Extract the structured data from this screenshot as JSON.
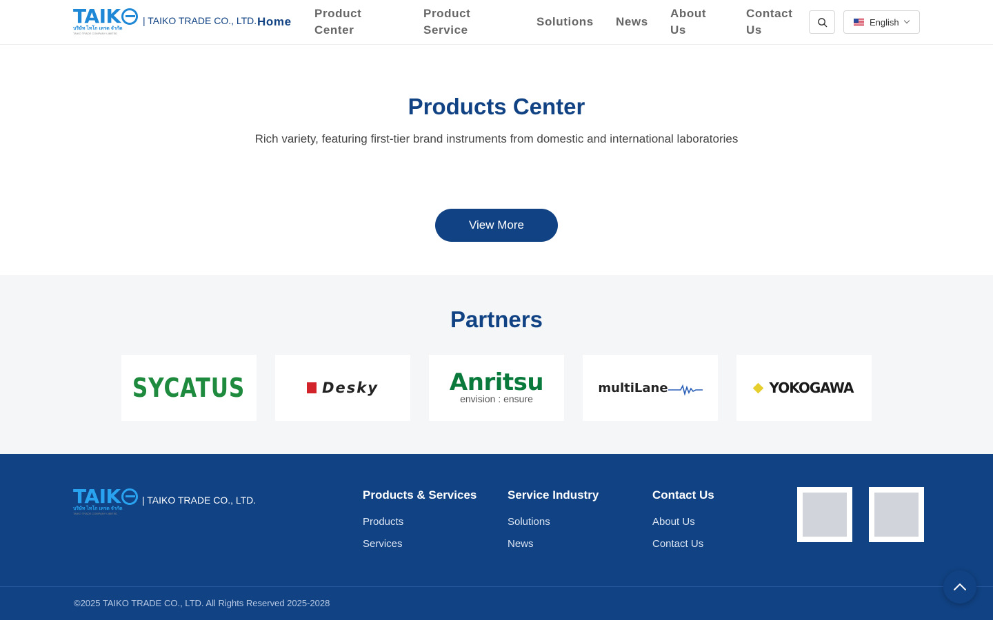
{
  "header": {
    "logo_text": "TAIK",
    "logo_thai": "บริษัท ไทโก เทรด จำกัด",
    "logo_tagline": "TAIKO TRADE COMPANY LIMITED",
    "company": "| TAIKO TRADE CO., LTD.",
    "nav": [
      {
        "label": "Home",
        "active": true
      },
      {
        "label": "Product Center"
      },
      {
        "label": "Product Service"
      },
      {
        "label": "Solutions"
      },
      {
        "label": "News"
      },
      {
        "label": "About Us"
      },
      {
        "label": "Contact Us"
      }
    ],
    "search_icon": "search-icon",
    "language": "English",
    "language_flag": "us-flag-icon"
  },
  "products": {
    "title": "Products Center",
    "subtitle": "Rich variety, featuring first-tier brand instruments from domestic and international laboratories",
    "view_more": "View More"
  },
  "partners": {
    "title": "Partners",
    "logos": [
      {
        "name": "SYCATUS"
      },
      {
        "name": "Desky"
      },
      {
        "name": "Anritsu",
        "tagline": "envision : ensure"
      },
      {
        "name": "multiLane"
      },
      {
        "name": "YOKOGAWA"
      }
    ]
  },
  "footer": {
    "company": "| TAIKO TRADE CO., LTD.",
    "columns": [
      {
        "heading": "Products & Services",
        "links": [
          "Products",
          "Services"
        ]
      },
      {
        "heading": "Service Industry",
        "links": [
          "Solutions",
          "News"
        ]
      },
      {
        "heading": "Contact Us",
        "links": [
          "About Us",
          "Contact Us"
        ]
      }
    ],
    "copyright": "©2025 TAIKO TRADE CO., LTD. All Rights Reserved 2025-2028"
  },
  "colors": {
    "brand_navy": "#114283",
    "logo_blue": "#1e88d6",
    "partners_bg": "#f5f6f8"
  }
}
